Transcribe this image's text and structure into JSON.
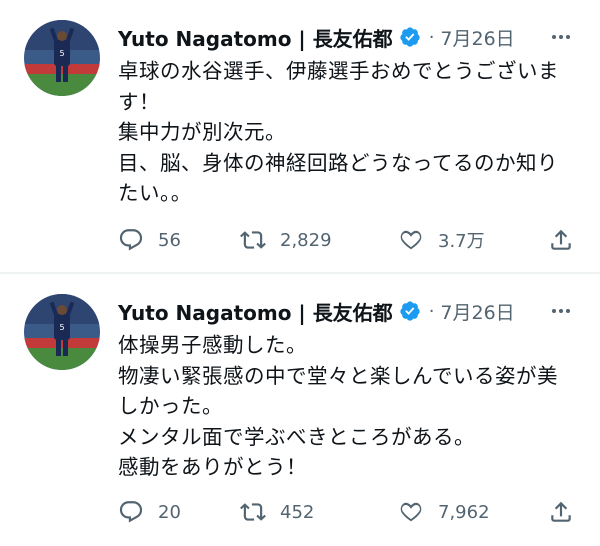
{
  "tweets": [
    {
      "author": "Yuto Nagatomo | 長友佑都",
      "separator": "·",
      "date": "7月26日",
      "lines": [
        "卓球の水谷選手、伊藤選手おめでとうございま",
        "す！",
        "集中力が別次元。",
        "目、脳、身体の神経回路どうなってるのか知り",
        "たい。。"
      ],
      "replies": "56",
      "retweets": "2,829",
      "likes": "3.7万"
    },
    {
      "author": "Yuto Nagatomo | 長友佑都",
      "separator": "·",
      "date": "7月26日",
      "lines": [
        "体操男子感動した。",
        "物凄い緊張感の中で堂々と楽しんでいる姿が美",
        "しかった。",
        "メンタル面で学ぶべきところがある。",
        "感動をありがとう！"
      ],
      "replies": "20",
      "retweets": "452",
      "likes": "7,962"
    }
  ],
  "colors": {
    "verified": "#1d9bf0",
    "muted": "#536471",
    "text": "#0f1419"
  }
}
